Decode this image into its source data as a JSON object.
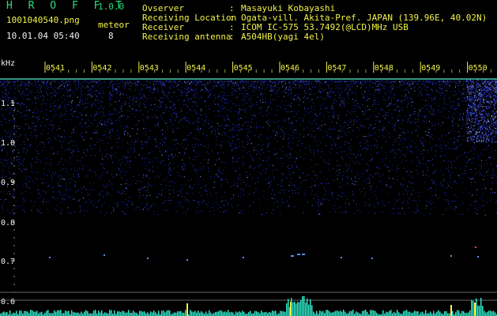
{
  "header": {
    "app_name": "H R O F F T",
    "version": "1.0.0",
    "filename": "1001040540.png",
    "datetime": "10.01.04 05:40",
    "meteor_label": "meteor",
    "meteor_count": "8"
  },
  "info": [
    {
      "key": "Ovserver",
      "value": "Masayuki Kobayashi"
    },
    {
      "key": "Receiving Location",
      "value": "Ogata-vill. Akita-Pref. JAPAN (139.96E, 40.02N)"
    },
    {
      "key": "Receiver",
      "value": "ICOM IC-575 53.7492(@LCD)MHz USB"
    },
    {
      "key": "Receiving antenna",
      "value": "A504HB(yagi 4el)"
    }
  ],
  "separator": ":",
  "axis": {
    "unit": "kHz",
    "time_ticks": [
      "0541",
      "0542",
      "0543",
      "0544",
      "0545",
      "0546",
      "0547",
      "0548",
      "0549",
      "0550"
    ],
    "freq_ticks": [
      "1.1",
      "1.0",
      "0.9",
      "0.8",
      "0.7",
      "0.6"
    ]
  },
  "colors": {
    "text_green": "#22e07a",
    "text_yellow": "#f2f24a",
    "marker_line": "#4ff0d0",
    "noise": "#2a3cff",
    "grid": "#8a8a8a"
  }
}
